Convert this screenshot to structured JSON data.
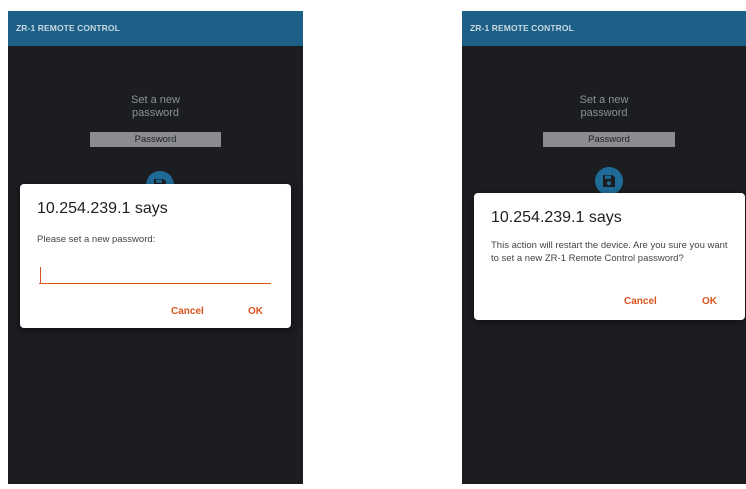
{
  "screens": [
    {
      "app_title": "ZR-1 REMOTE CONTROL",
      "prompt": "Set a new\npassword",
      "password_field": "Password",
      "dialog": {
        "title": "10.254.239.1 says",
        "message": "Please set a new password:",
        "input_value": "",
        "cancel_label": "Cancel",
        "ok_label": "OK"
      }
    },
    {
      "app_title": "ZR-1 REMOTE CONTROL",
      "prompt": "Set a new\npassword",
      "password_field": "Password",
      "dialog": {
        "title": "10.254.239.1 says",
        "message": "This action will restart the device. Are you sure you want to set a new ZR-1 Remote Control password?",
        "cancel_label": "Cancel",
        "ok_label": "OK"
      }
    }
  ],
  "colors": {
    "app_bar": "#1c5f87",
    "background": "#1b1d21",
    "accent": "#d9541e",
    "save_button": "#1f6b98"
  },
  "icons": {
    "save": "floppy-disk-icon"
  }
}
